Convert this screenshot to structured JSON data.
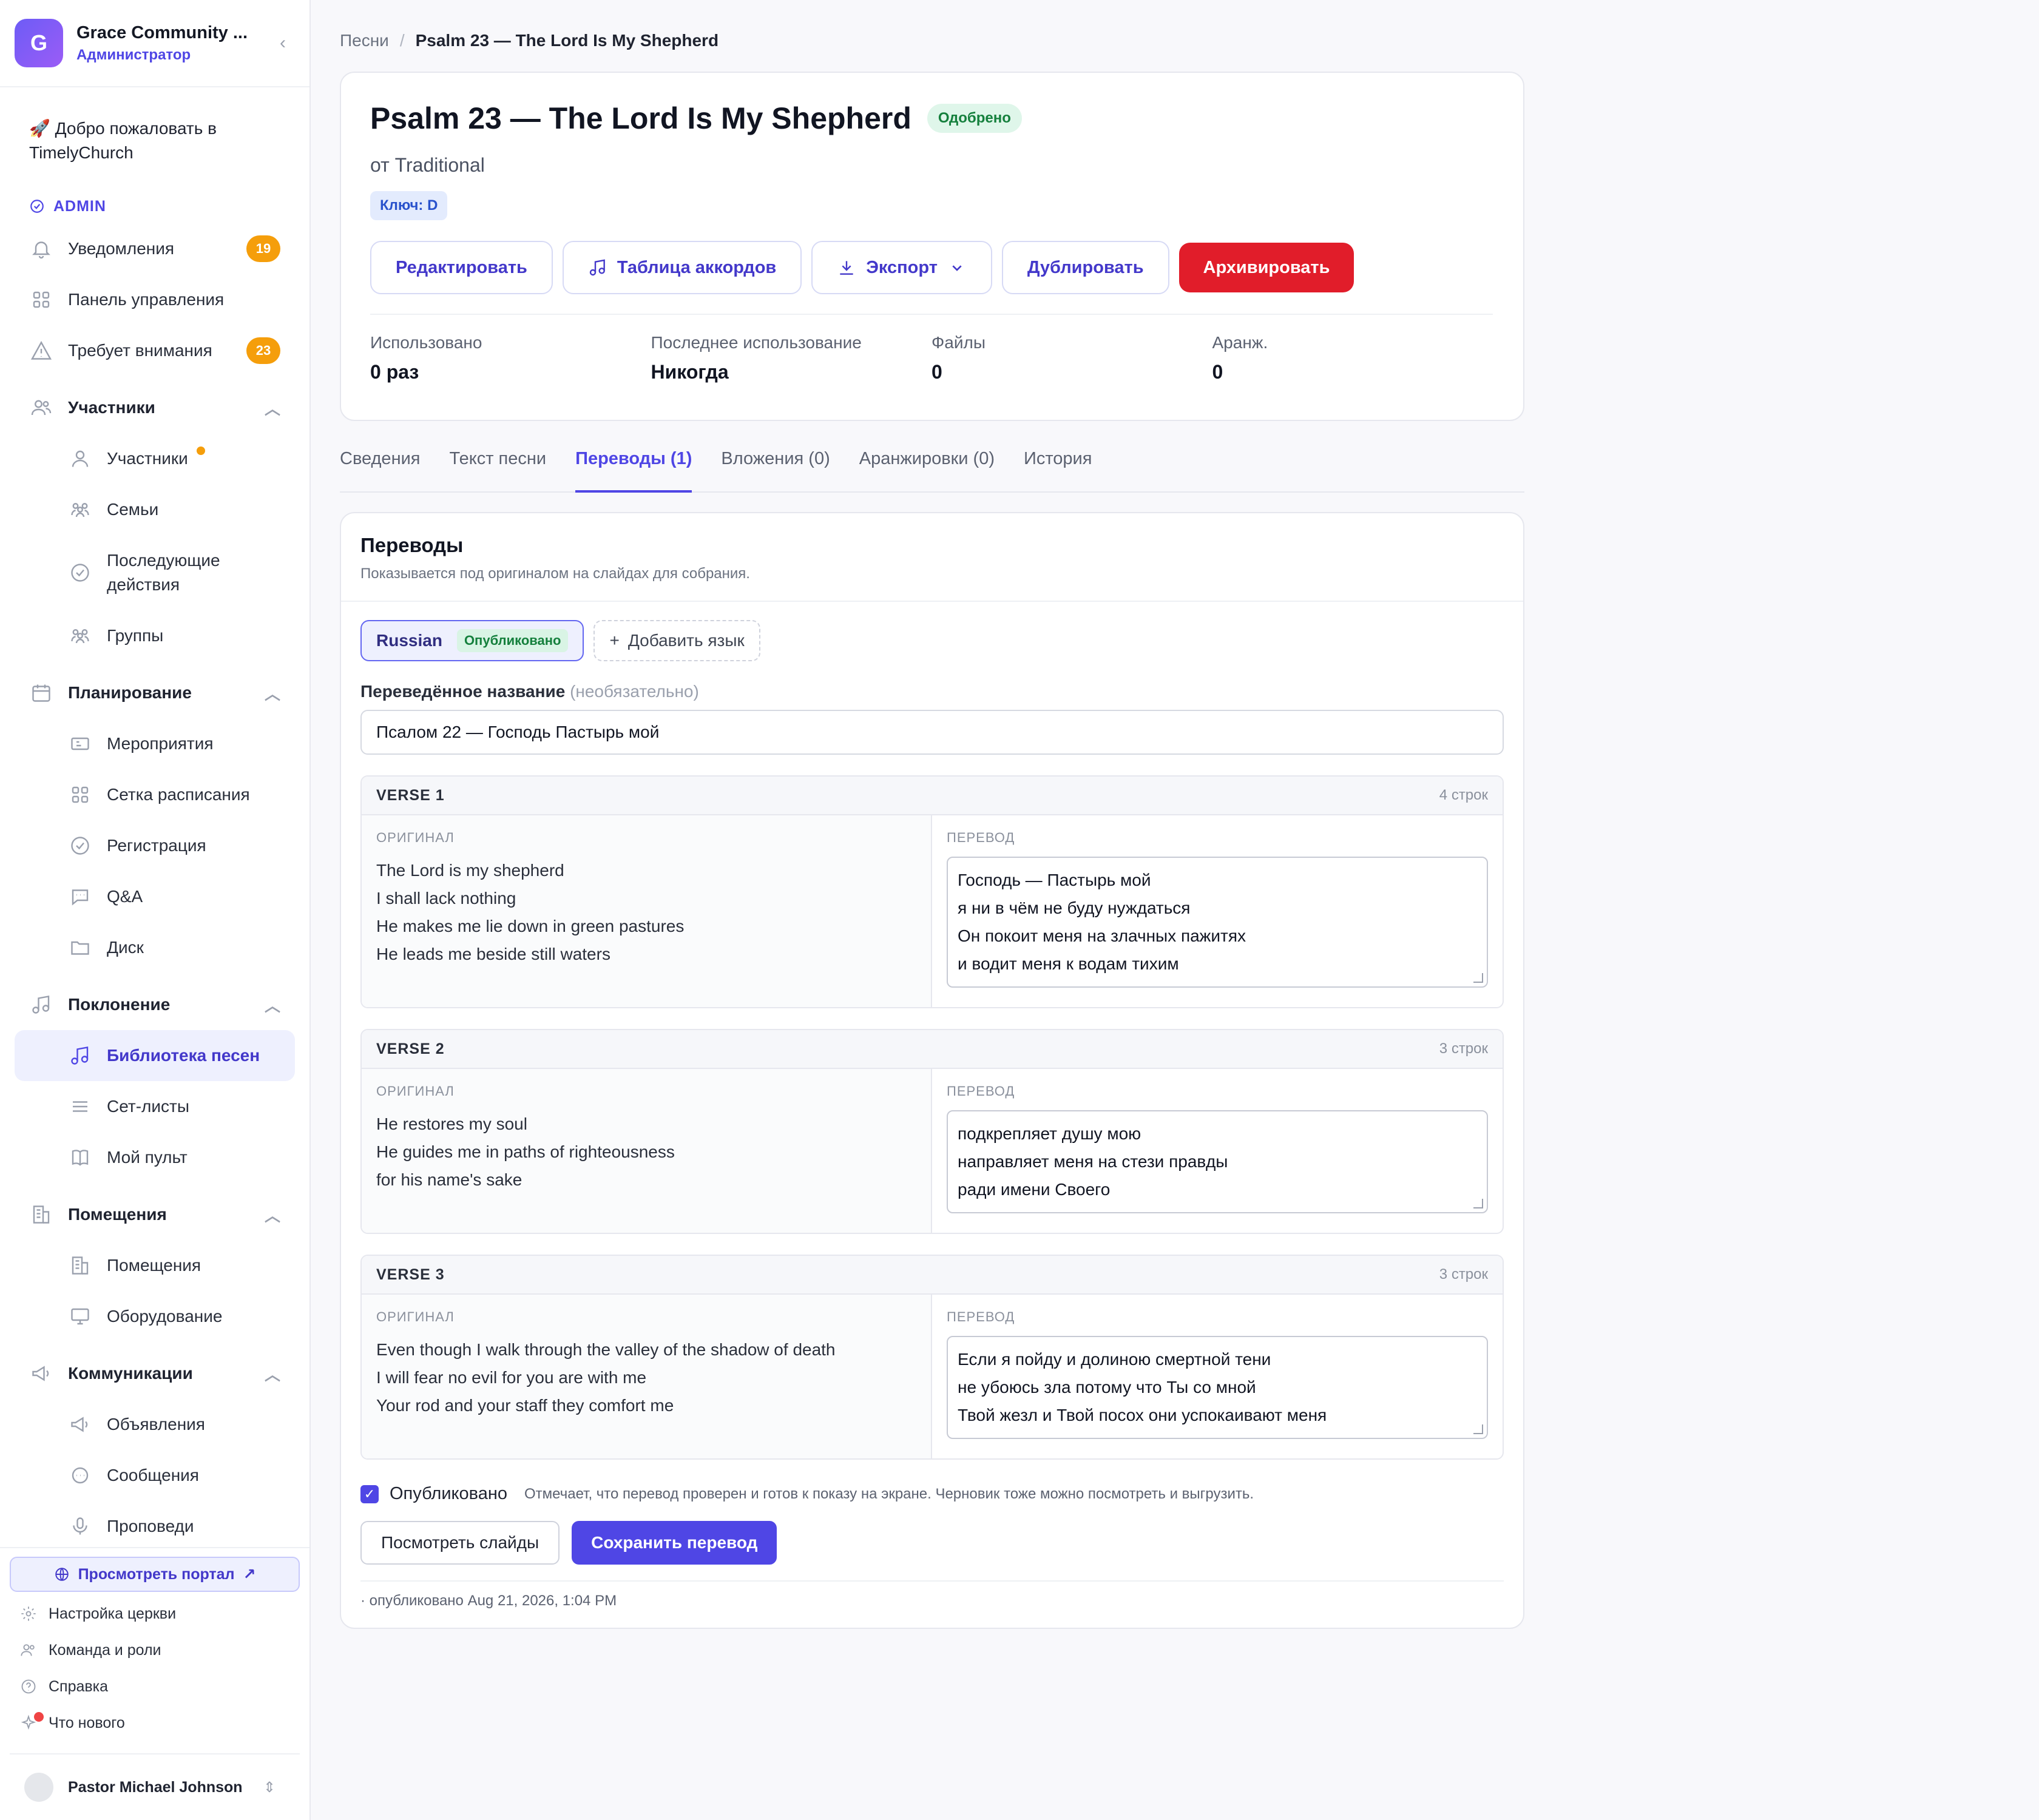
{
  "org": {
    "initial": "G",
    "name": "Grace Community ...",
    "role": "Администратор"
  },
  "sidebar": {
    "welcome": "🚀 Добро пожаловать в TimelyChurch",
    "admin_label": "ADMIN",
    "top_items": [
      {
        "label": "Уведомления",
        "badge": "19",
        "icon": "bell-icon"
      },
      {
        "label": "Панель управления",
        "icon": "grid-icon"
      },
      {
        "label": "Требует внимания",
        "badge": "23",
        "icon": "warning-icon"
      }
    ],
    "sections": [
      {
        "label": "Участники",
        "icon": "users-icon",
        "items": [
          {
            "label": "Участники",
            "icon": "user-icon"
          },
          {
            "label": "Семьи",
            "icon": "family-icon"
          },
          {
            "label": "Последующие действия",
            "icon": "check-circle-icon"
          },
          {
            "label": "Группы",
            "icon": "groups-icon"
          }
        ]
      },
      {
        "label": "Планирование",
        "icon": "calendar-icon",
        "items": [
          {
            "label": "Мероприятия",
            "icon": "ticket-icon"
          },
          {
            "label": "Сетка расписания",
            "icon": "grid-icon"
          },
          {
            "label": "Регистрация",
            "icon": "check-circle-icon"
          },
          {
            "label": "Q&A",
            "icon": "chat-icon"
          },
          {
            "label": "Диск",
            "icon": "folder-icon"
          }
        ]
      },
      {
        "label": "Поклонение",
        "icon": "music-icon",
        "items": [
          {
            "label": "Библиотека песен",
            "icon": "music-icon"
          },
          {
            "label": "Сет-листы",
            "icon": "list-icon"
          },
          {
            "label": "Мой пульт",
            "icon": "book-icon"
          }
        ]
      },
      {
        "label": "Помещения",
        "icon": "building-icon",
        "items": [
          {
            "label": "Помещения",
            "icon": "building-icon"
          },
          {
            "label": "Оборудование",
            "icon": "monitor-icon"
          }
        ]
      },
      {
        "label": "Коммуникации",
        "icon": "megaphone-icon",
        "items": [
          {
            "label": "Объявления",
            "icon": "megaphone-icon"
          },
          {
            "label": "Сообщения",
            "icon": "chat-icon"
          },
          {
            "label": "Проповеди",
            "icon": "mic-icon"
          }
        ]
      }
    ],
    "portal_button": "Просмотреть портал",
    "utilities": [
      {
        "label": "Настройка церкви",
        "icon": "gear-icon"
      },
      {
        "label": "Команда и роли",
        "icon": "users-icon"
      },
      {
        "label": "Справка",
        "icon": "help-icon"
      },
      {
        "label": "Что нового",
        "icon": "sparkle-icon"
      }
    ],
    "user": {
      "name": "Pastor Michael Johnson"
    }
  },
  "breadcrumb": {
    "parent": "Песни",
    "current": "Psalm 23 — The Lord Is My Shepherd"
  },
  "song": {
    "title": "Psalm 23 — The Lord Is My Shepherd",
    "status": "Одобрено",
    "author": "от Traditional",
    "key": "Ключ: D",
    "actions": {
      "edit": "Редактировать",
      "chords": "Таблица аккордов",
      "export": "Экспорт",
      "duplicate": "Дублировать",
      "archive": "Архивировать"
    },
    "stats": [
      {
        "label": "Использовано",
        "value": "0 раз"
      },
      {
        "label": "Последнее использование",
        "value": "Никогда"
      },
      {
        "label": "Файлы",
        "value": "0"
      },
      {
        "label": "Аранж.",
        "value": "0"
      }
    ]
  },
  "tabs": [
    "Сведения",
    "Текст песни",
    "Переводы (1)",
    "Вложения (0)",
    "Аранжировки (0)",
    "История"
  ],
  "translations": {
    "title": "Переводы",
    "subtitle": "Показывается под оригиналом на слайдах для собрания.",
    "language": "Russian",
    "language_status": "Опубликовано",
    "add_language": "Добавить язык",
    "title_label": "Переведённое название",
    "title_optional": "(необязательно)",
    "title_value": "Псалом 22 — Господь Пастырь мой",
    "original_label": "ОРИГИНАЛ",
    "translation_label": "ПЕРЕВОД",
    "verses": [
      {
        "name": "VERSE 1",
        "count": "4 строк",
        "original": "The Lord is my shepherd\nI shall lack nothing\nHe makes me lie down in green pastures\nHe leads me beside still waters",
        "translation": "Господь — Пастырь мой\nя ни в чём не буду нуждаться\nОн покоит меня на злачных пажитях\nи водит меня к водам тихим"
      },
      {
        "name": "VERSE 2",
        "count": "3 строк",
        "original": "He restores my soul\nHe guides me in paths of righteousness\nfor his name's sake",
        "translation": "подкрепляет душу мою\nнаправляет меня на стези правды\nради имени Своего"
      },
      {
        "name": "VERSE 3",
        "count": "3 строк",
        "original": "Even though I walk through the valley of the shadow of death\nI will fear no evil for you are with me\nYour rod and your staff they comfort me",
        "translation": "Если я пойду и долиною смертной тени\nне убоюсь зла потому что Ты со мной\nТвой жезл и Твой посох они успокаивают меня"
      }
    ],
    "published_label": "Опубликовано",
    "published_hint": "Отмечает, что перевод проверен и готов к показу на экране. Черновик тоже можно посмотреть и выгрузить.",
    "view_slides": "Посмотреть слайды",
    "save": "Сохранить перевод",
    "meta": "· опубликовано Aug 21, 2026, 1:04 PM"
  }
}
